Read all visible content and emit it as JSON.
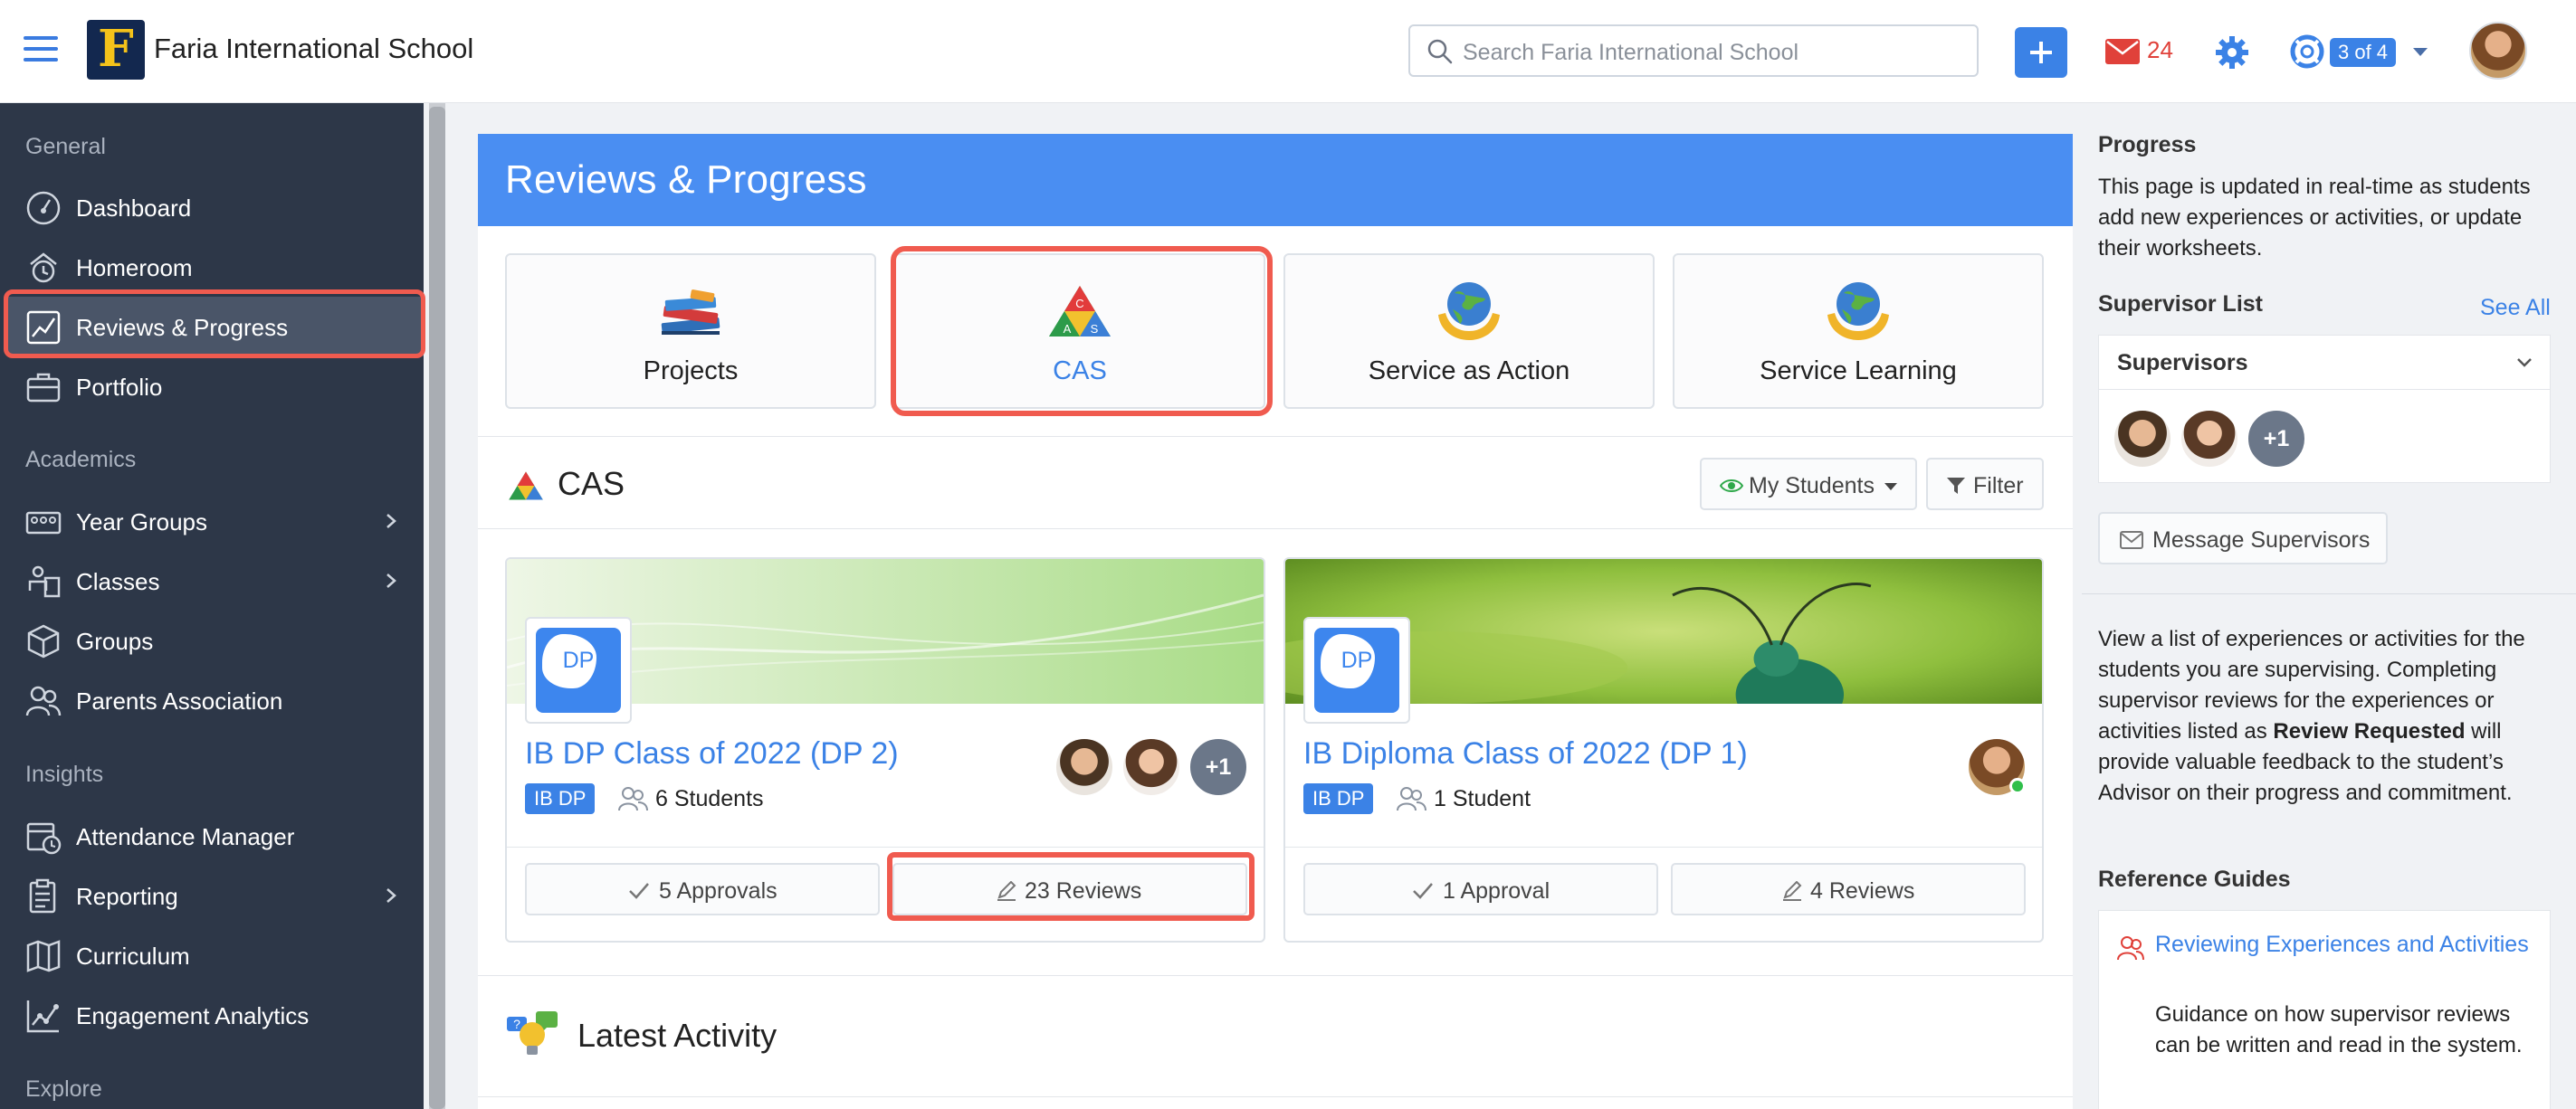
{
  "topbar": {
    "school_name": "Faria International School",
    "search_placeholder": "Search Faria International School",
    "mail_count": "24",
    "help_badge": "3 of 4"
  },
  "sidebar": {
    "sections": [
      {
        "header": "General",
        "items": [
          {
            "label": "Dashboard",
            "icon": "dashboard-icon"
          },
          {
            "label": "Homeroom",
            "icon": "homeroom-icon"
          },
          {
            "label": "Reviews & Progress",
            "icon": "chart-line-icon",
            "active": true
          },
          {
            "label": "Portfolio",
            "icon": "briefcase-icon"
          }
        ]
      },
      {
        "header": "Academics",
        "items": [
          {
            "label": "Year Groups",
            "icon": "year-groups-icon",
            "chevron": true
          },
          {
            "label": "Classes",
            "icon": "classes-icon",
            "chevron": true
          },
          {
            "label": "Groups",
            "icon": "cube-icon"
          },
          {
            "label": "Parents Association",
            "icon": "people-icon"
          }
        ]
      },
      {
        "header": "Insights",
        "items": [
          {
            "label": "Attendance Manager",
            "icon": "calendar-clock-icon"
          },
          {
            "label": "Reporting",
            "icon": "report-icon",
            "chevron": true
          },
          {
            "label": "Curriculum",
            "icon": "map-icon"
          },
          {
            "label": "Engagement Analytics",
            "icon": "analytics-icon"
          }
        ]
      },
      {
        "header": "Explore",
        "items": []
      }
    ]
  },
  "main": {
    "title": "Reviews & Progress",
    "categories": [
      {
        "label": "Projects",
        "icon": "books-icon"
      },
      {
        "label": "CAS",
        "icon": "cas-triangle-icon",
        "active": true
      },
      {
        "label": "Service as Action",
        "icon": "globe-hands-icon"
      },
      {
        "label": "Service Learning",
        "icon": "globe-hands-icon"
      }
    ],
    "cas_heading": "CAS",
    "my_students_label": "My Students",
    "filter_label": "Filter",
    "classes": [
      {
        "title": "IB DP Class of 2022 (DP 2)",
        "tile": "DP",
        "badge": "IB DP",
        "students": "6 Students",
        "more_avatars": "+1",
        "approvals": "5 Approvals",
        "reviews": "23 Reviews"
      },
      {
        "title": "IB Diploma Class of 2022 (DP 1)",
        "tile": "DP",
        "badge": "IB DP",
        "students": "1 Student",
        "approvals": "1 Approval",
        "reviews": "4 Reviews"
      }
    ],
    "latest_activity": "Latest Activity"
  },
  "right_panel": {
    "progress_title": "Progress",
    "progress_text": "This page is updated in real-time as students add new experiences or activities, or update their worksheets.",
    "supervisor_list_title": "Supervisor List",
    "see_all": "See All",
    "supervisors_label": "Supervisors",
    "more_supervisors": "+1",
    "message_supervisors": "Message Supervisors",
    "description_1": "View a list of experiences or activities for the students you are supervising. Completing supervisor reviews for the experiences or activities listed as ",
    "description_bold": "Review Requested",
    "description_2": " will provide valuable feedback to the student’s Advisor on their progress and commitment.",
    "reference_title": "Reference Guides",
    "ref_link": "Reviewing Experiences and Activities",
    "ref_desc": "Guidance on how supervisor reviews can be written and read in the system."
  },
  "colors": {
    "accent": "#3b82e6",
    "sidebar_bg": "#2d3748",
    "highlight": "#f05b4f"
  }
}
